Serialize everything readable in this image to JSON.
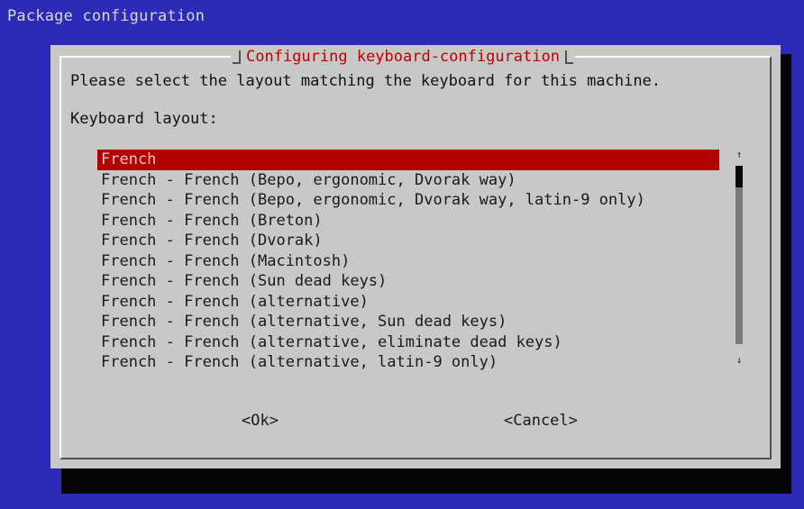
{
  "screen": {
    "title": "Package configuration"
  },
  "dialog": {
    "title": "Configuring keyboard-configuration",
    "prompt": "Please select the layout matching the keyboard for this machine.",
    "field_label": "Keyboard layout:",
    "selected_index": 0,
    "items": [
      "French",
      "French - French (Bepo, ergonomic, Dvorak way)",
      "French - French (Bepo, ergonomic, Dvorak way, latin-9 only)",
      "French - French (Breton)",
      "French - French (Dvorak)",
      "French - French (Macintosh)",
      "French - French (Sun dead keys)",
      "French - French (alternative)",
      "French - French (alternative, Sun dead keys)",
      "French - French (alternative, eliminate dead keys)",
      "French - French (alternative, latin-9 only)"
    ],
    "scrollbar": {
      "up_arrow": "↑",
      "down_arrow": "↓"
    },
    "buttons": {
      "ok": "<Ok>",
      "cancel": "<Cancel>"
    }
  },
  "colors": {
    "background": "#2b2bb8",
    "dialog": "#c8c8c8",
    "title": "#c00000",
    "selection": "#b40000"
  }
}
